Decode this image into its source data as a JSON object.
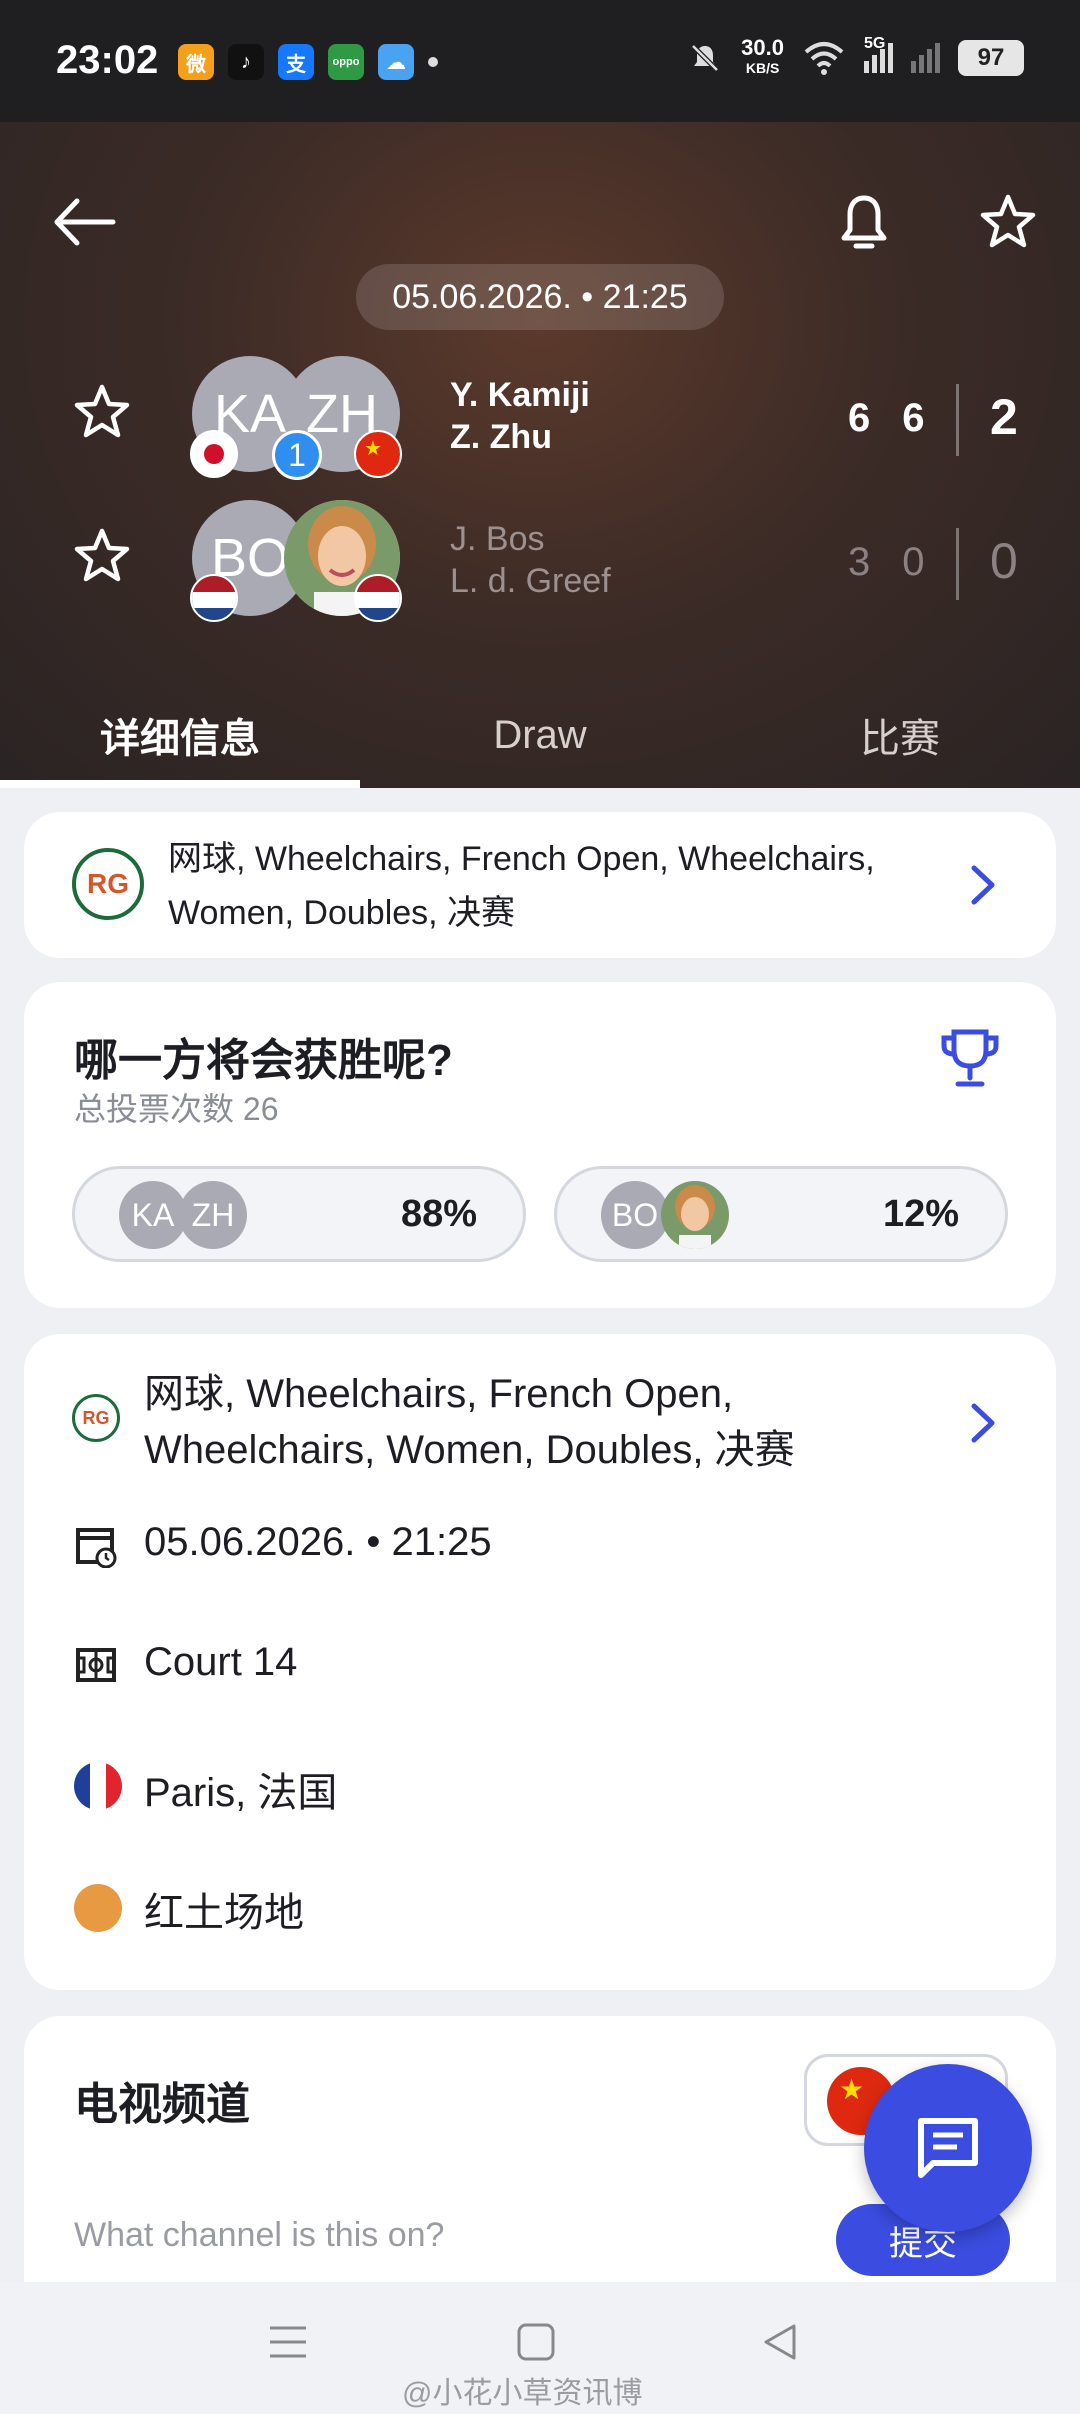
{
  "status_bar": {
    "time": "23:02",
    "apps": [
      {
        "name": "weibo",
        "glyph": "微",
        "color": "#f59f1b"
      },
      {
        "name": "tiktok",
        "glyph": "♪",
        "color": "#111111"
      },
      {
        "name": "alipay",
        "glyph": "支",
        "color": "#1677ff"
      },
      {
        "name": "oppo",
        "glyph": "oppo",
        "color": "#2e9a45"
      },
      {
        "name": "weather",
        "glyph": "☁",
        "color": "#4aa3f0"
      }
    ],
    "net_speed": "30.0",
    "net_unit": "KB/S",
    "signal": "5G",
    "battery": "97"
  },
  "header": {
    "datetime": "05.06.2026. • 21:25",
    "team1": {
      "avatar1": "KA",
      "avatar2": "ZH",
      "seed": "1",
      "player1": "Y. Kamiji",
      "player2": "Z. Zhu",
      "sets": [
        "6",
        "6"
      ],
      "total": "2"
    },
    "team2": {
      "avatar1": "BO",
      "player1": "J. Bos",
      "player2": "L. d. Greef",
      "sets": [
        "3",
        "0"
      ],
      "total": "0"
    },
    "tabs": [
      "详细信息",
      "Draw",
      "比赛"
    ]
  },
  "category_card": {
    "text": "网球, Wheelchairs, French Open, Wheelchairs, Women, Doubles, 决赛"
  },
  "poll": {
    "title": "哪一方将会获胜呢?",
    "total_votes": "总投票次数 26",
    "option1": {
      "avatar1": "KA",
      "avatar2": "ZH",
      "percent": "88%"
    },
    "option2": {
      "avatar1": "BO",
      "percent": "12%"
    }
  },
  "info": {
    "category": "网球, Wheelchairs, French Open, Wheelchairs, Women, Doubles, 决赛",
    "datetime": "05.06.2026. • 21:25",
    "court": "Court 14",
    "location": "Paris, 法国",
    "surface": "红土场地",
    "surface_color": "#e89a42"
  },
  "tv": {
    "title": "电视频道",
    "question": "What channel is this on?",
    "submit": "提交"
  },
  "watermark": "@小花小草资讯博",
  "colors": {
    "accent": "#3a4de0"
  }
}
